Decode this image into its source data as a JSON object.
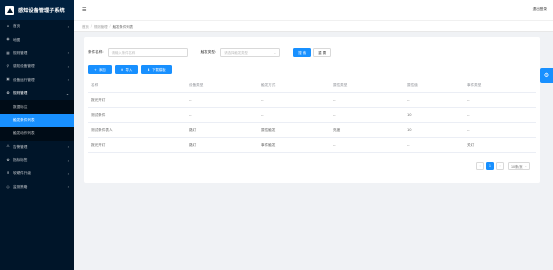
{
  "app": {
    "title": "感知设备管理子系统"
  },
  "header": {
    "logout": "退出登录",
    "toggle_icon": "menu-fold-icon"
  },
  "sidebar": {
    "items": [
      {
        "label": "首页",
        "icon": "home-icon",
        "glyph": "⌂",
        "arrow": "›"
      },
      {
        "label": "地图",
        "icon": "map-icon",
        "glyph": "◉",
        "arrow": ""
      },
      {
        "label": "规则管理",
        "icon": "rules-icon",
        "glyph": "▦",
        "arrow": "›"
      },
      {
        "label": "感知设备管理",
        "icon": "location-icon",
        "glyph": "⚲",
        "arrow": "›"
      },
      {
        "label": "设备运行管理",
        "icon": "device-icon",
        "glyph": "▣",
        "arrow": "›"
      },
      {
        "label": "规则管理",
        "icon": "rules-icon",
        "glyph": "⚙",
        "arrow": "⌄"
      }
    ],
    "subitems": [
      {
        "label": "数据标注"
      },
      {
        "label": "触发条件列表"
      },
      {
        "label": "触发动作列表"
      }
    ],
    "items_after": [
      {
        "label": "告警管理",
        "icon": "alarm-icon",
        "glyph": "⚠",
        "arrow": "›"
      },
      {
        "label": "指标标签",
        "icon": "tag-icon",
        "glyph": "✿",
        "arrow": "›"
      },
      {
        "label": "软硬件升级",
        "icon": "upgrade-icon",
        "glyph": "⬆",
        "arrow": "›"
      },
      {
        "label": "监测策略",
        "icon": "strategy-icon",
        "glyph": "◎",
        "arrow": "›"
      }
    ]
  },
  "breadcrumb": {
    "home": "首页",
    "level1": "规则管理",
    "current": "触发条件列表",
    "sep": "/"
  },
  "search": {
    "name_label": "条件名称:",
    "name_placeholder": "请输入条件名称",
    "type_label": "触发类型:",
    "type_placeholder": "请选择触发类型",
    "search_btn": "搜 索",
    "reset_btn": "重 置"
  },
  "actions": {
    "add": "添加",
    "add_glyph": "+",
    "import": "导入",
    "import_glyph": "⬆",
    "template": "下载模板",
    "template_glyph": "⬇"
  },
  "table": {
    "headers": [
      "名称",
      "设备类型",
      "触发方式",
      "属性类型",
      "属性值",
      "事件类型"
    ],
    "rows": [
      [
        "报光开灯",
        "--",
        "--",
        "--",
        "--",
        "--"
      ],
      [
        "测试条件",
        "--",
        "--",
        "--",
        "10",
        "--"
      ],
      [
        "测试条件表人",
        "路灯",
        "属性触发",
        "亮度",
        "10",
        "--"
      ],
      [
        "报光开灯",
        "路灯",
        "事件触发",
        "--",
        "--",
        "关灯"
      ]
    ]
  },
  "pagination": {
    "prev": "‹",
    "page": "1",
    "next": "›",
    "size": "10条/页"
  },
  "float": {
    "icon": "settings-icon",
    "glyph": "⚙"
  },
  "colors": {
    "sidebar": "#001529",
    "primary": "#1890ff",
    "background": "#f0f2f5"
  }
}
